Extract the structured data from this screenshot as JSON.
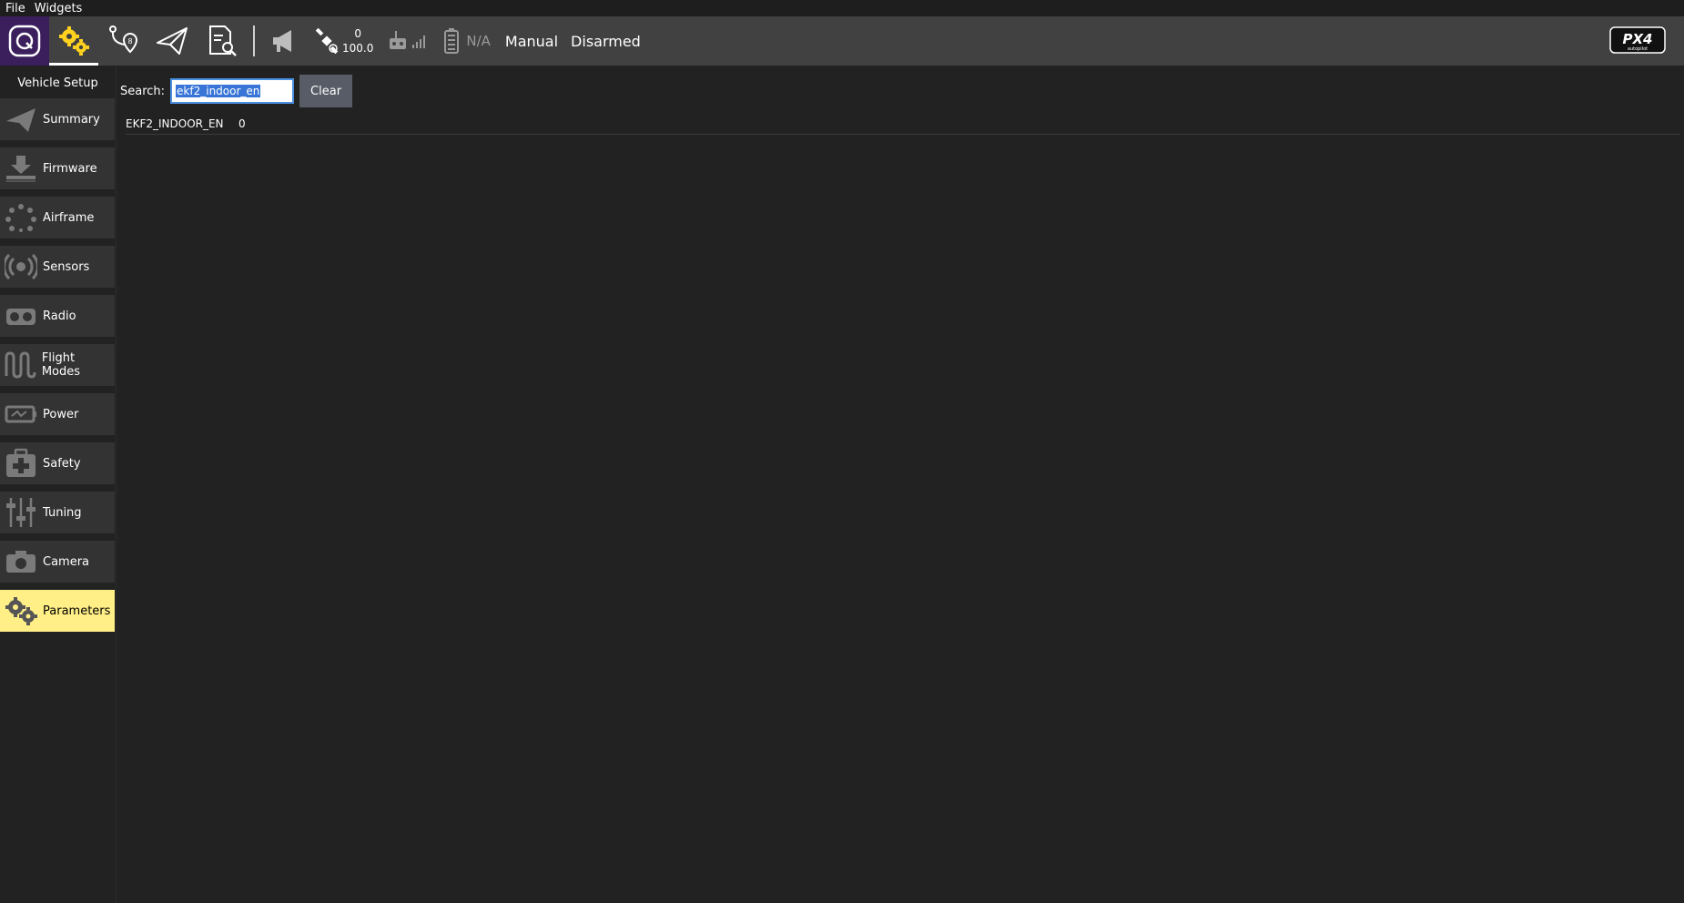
{
  "menubar": {
    "items": [
      "File",
      "Widgets"
    ]
  },
  "toolbar": {
    "buttons": [
      {
        "name": "qgc-logo-icon"
      },
      {
        "name": "vehicle-setup-gears-icon",
        "active": true
      },
      {
        "name": "plan-waypoint-icon"
      },
      {
        "name": "fly-paper-plane-icon"
      },
      {
        "name": "analyze-document-icon"
      }
    ],
    "gps_count": "0",
    "gps_hdop": "100.0",
    "battery_text": "N/A",
    "flight_mode": "Manual",
    "arm_status": "Disarmed",
    "colors": {
      "accent_yellow": "#ffd21f",
      "qgc_purple": "#3a1f5c",
      "toolbar_bg": "#414141"
    }
  },
  "sidebar": {
    "title": "Vehicle Setup",
    "items": [
      {
        "label": "Summary",
        "icon": "paper-plane-icon"
      },
      {
        "label": "Firmware",
        "icon": "download-icon"
      },
      {
        "label": "Airframe",
        "icon": "airframe-dots-icon"
      },
      {
        "label": "Sensors",
        "icon": "sensor-waves-icon"
      },
      {
        "label": "Radio",
        "icon": "radio-controller-icon"
      },
      {
        "label": "Flight Modes",
        "icon": "flight-modes-wave-icon"
      },
      {
        "label": "Power",
        "icon": "battery-power-icon"
      },
      {
        "label": "Safety",
        "icon": "first-aid-kit-icon"
      },
      {
        "label": "Tuning",
        "icon": "sliders-icon"
      },
      {
        "label": "Camera",
        "icon": "camera-icon"
      },
      {
        "label": "Parameters",
        "icon": "gears-icon",
        "selected": true
      }
    ]
  },
  "main": {
    "search_label": "Search:",
    "search_value": "ekf2_indoor_en",
    "clear_label": "Clear",
    "params": [
      {
        "name": "EKF2_INDOOR_EN",
        "value": "0"
      }
    ]
  }
}
